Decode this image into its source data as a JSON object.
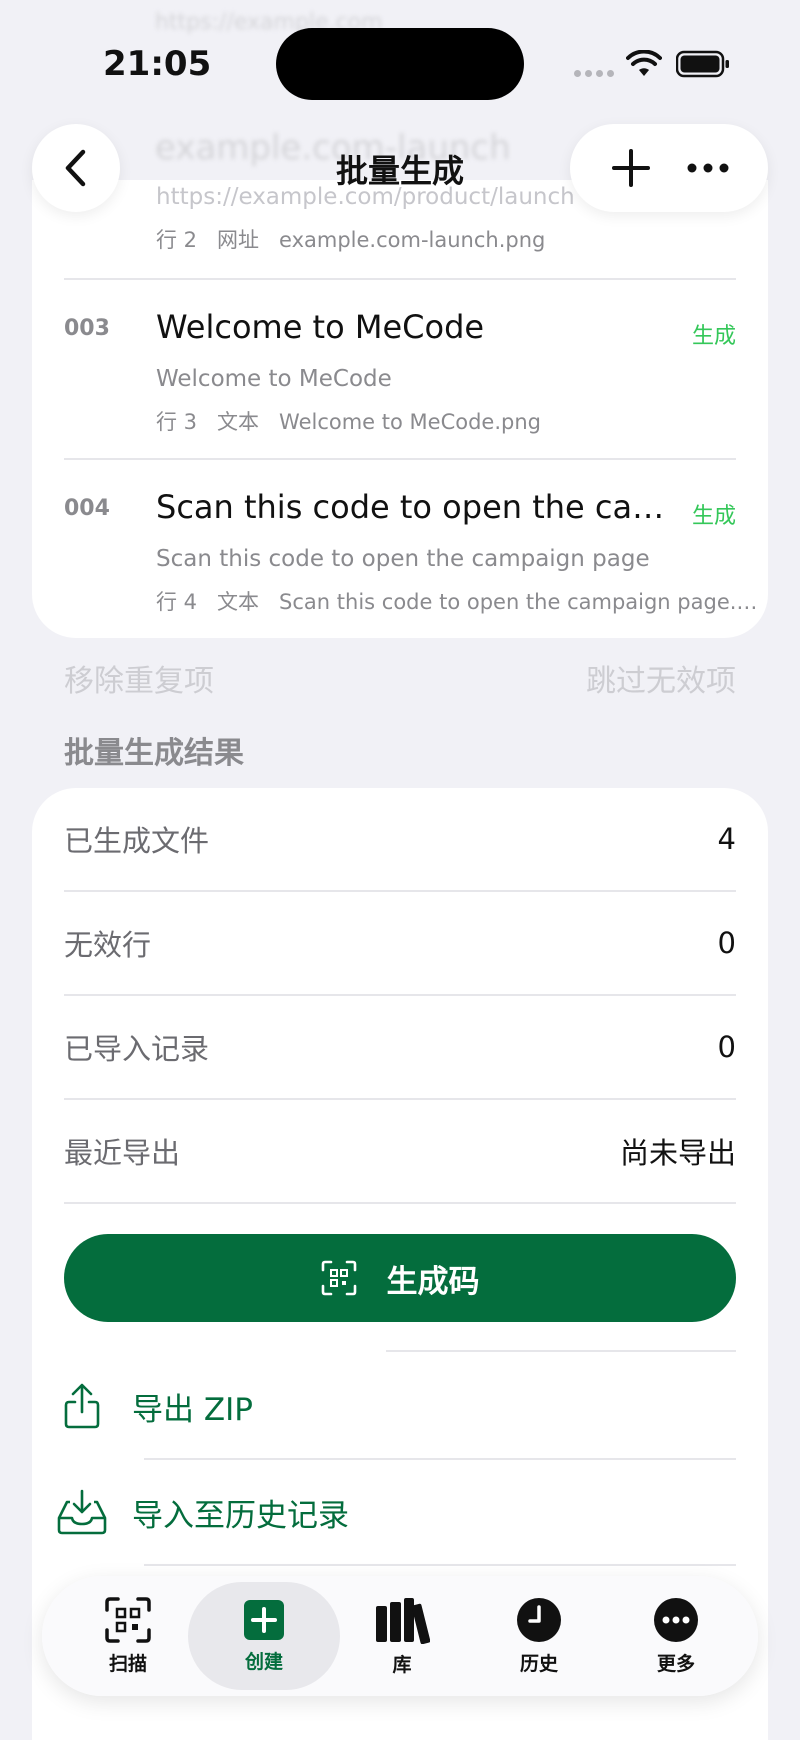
{
  "status_bar": {
    "time": "21:05"
  },
  "nav": {
    "title": "批量生成"
  },
  "ghost_rows": {
    "row2_title": "example.com-launch",
    "row2_url": "https://example.com/product/launch",
    "row2_meta_row": "行 2",
    "row2_meta_type": "网址",
    "row2_meta_file": "example.com-launch.png"
  },
  "rows": [
    {
      "index": "003",
      "title": "Welcome to MeCode",
      "subtitle": "Welcome to MeCode",
      "meta_row": "行 3",
      "meta_type": "文本",
      "meta_file": "Welcome to MeCode.png",
      "status": "生成"
    },
    {
      "index": "004",
      "title": "Scan this code to open the campaign page",
      "subtitle": "Scan this code to open the campaign page",
      "meta_row": "行 4",
      "meta_type": "文本",
      "meta_file": "Scan this code to open the campaign page.png",
      "status": "生成"
    }
  ],
  "secondary_actions": {
    "remove_duplicates": "移除重复项",
    "skip_invalid": "跳过无效项"
  },
  "results": {
    "section_title": "批量生成结果",
    "stats": [
      {
        "label": "已生成文件",
        "value": "4"
      },
      {
        "label": "无效行",
        "value": "0"
      },
      {
        "label": "已导入记录",
        "value": "0"
      },
      {
        "label": "最近导出",
        "value": "尚未导出"
      }
    ],
    "generate_label": "生成码",
    "export_zip_label": "导出 ZIP",
    "import_history_label": "导入至历史记录"
  },
  "tabbar": {
    "items": [
      {
        "label": "扫描",
        "icon": "qr-scan-icon"
      },
      {
        "label": "创建",
        "icon": "plus-square-icon"
      },
      {
        "label": "库",
        "icon": "books-icon"
      },
      {
        "label": "历史",
        "icon": "clock-icon"
      },
      {
        "label": "更多",
        "icon": "more-circle-icon"
      }
    ]
  },
  "colors": {
    "accent": "#046d3d",
    "status_green": "#34c759",
    "background": "#f1f1f6"
  }
}
